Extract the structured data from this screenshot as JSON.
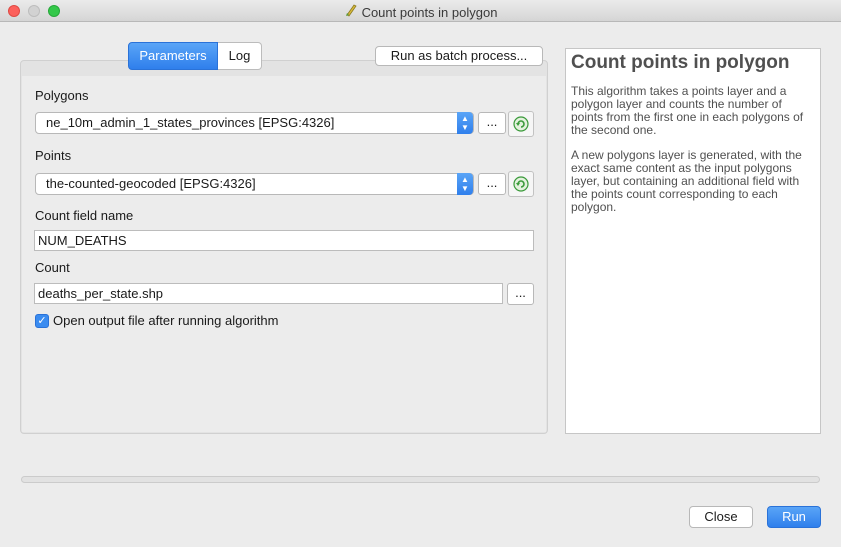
{
  "window": {
    "title": "Count points in polygon",
    "icon": "qgis-edit-icon"
  },
  "tabs": [
    {
      "label": "Parameters",
      "active": true
    },
    {
      "label": "Log",
      "active": false
    }
  ],
  "batch_button": "Run as batch process...",
  "params": {
    "polygons": {
      "label": "Polygons",
      "value": "ne_10m_admin_1_states_provinces [EPSG:4326]",
      "browse": "..."
    },
    "points": {
      "label": "Points",
      "value": "the-counted-geocoded [EPSG:4326]",
      "browse": "..."
    },
    "count_field": {
      "label": "Count field name",
      "value": "NUM_DEATHS"
    },
    "count": {
      "label": "Count",
      "value": "deaths_per_state.shp",
      "browse": "..."
    },
    "open_output": {
      "label": "Open output file after running algorithm",
      "checked": true
    }
  },
  "help": {
    "title": "Count points in polygon",
    "paragraphs": [
      "This algorithm takes a points layer and a polygon layer and counts the number of points from the first one in each polygons of the second one.",
      "A new polygons layer is generated, with the exact same content as the input polygons layer, but containing an additional field with the points count corresponding to each polygon."
    ]
  },
  "progress": 0,
  "buttons": {
    "close": "Close",
    "run": "Run"
  },
  "colors": {
    "accent": "#3b8cf0",
    "iterate": "#3a9a3a"
  }
}
